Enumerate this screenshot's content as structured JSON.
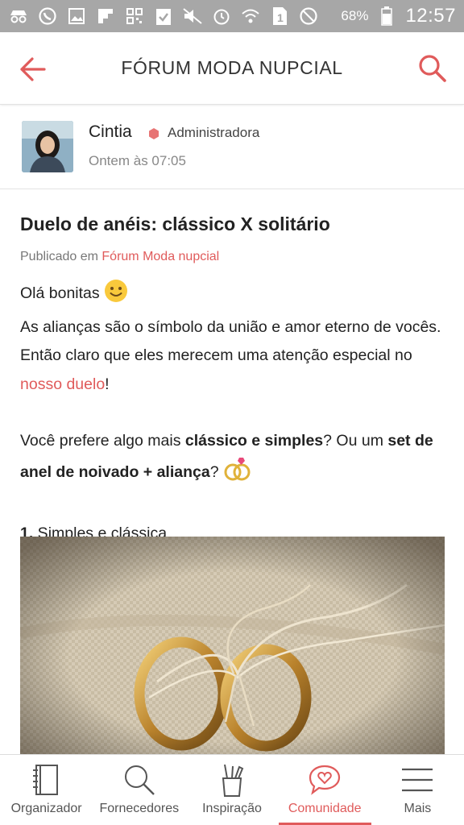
{
  "statusbar": {
    "left_icons": [
      "incognito-icon",
      "whatsapp-icon",
      "image-icon",
      "flipboard-icon",
      "qr-icon",
      "clipboard-icon",
      "mute-icon",
      "alarm-icon",
      "wifi-icon",
      "sim-icon",
      "block-icon"
    ],
    "battery": "68%",
    "time": "12:57"
  },
  "appbar": {
    "title": "FÓRUM MODA NUPCIAL",
    "back_icon": "arrow-left-icon",
    "search_icon": "search-icon"
  },
  "author": {
    "name": "Cintia",
    "role": "Administradora",
    "time": "Ontem às 07:05"
  },
  "post": {
    "title": "Duelo de anéis: clássico X solitário",
    "published_prefix": "Publicado em ",
    "published_forum": "Fórum Moda nupcial",
    "greeting": "Olá bonitas",
    "p1_text": "As alianças são o símbolo da união e amor eterno de vocês. Então claro que eles merecem uma atenção especial no ",
    "p1_link": "nosso duelo",
    "p1_end": "!",
    "p2_a": "Você prefere algo mais ",
    "p2_b": "clássico e simples",
    "p2_c": "? Ou um ",
    "p2_d": "set de anel de noivado + aliança",
    "p2_e": "?",
    "item1_num": "1.",
    "item1_text": " Simples e clássica"
  },
  "bottomnav": [
    {
      "label": "Organizador",
      "icon": "notebook-icon",
      "active": false
    },
    {
      "label": "Fornecedores",
      "icon": "search-icon",
      "active": false
    },
    {
      "label": "Inspiração",
      "icon": "pencil-cup-icon",
      "active": false
    },
    {
      "label": "Comunidade",
      "icon": "heart-chat-icon",
      "active": true
    },
    {
      "label": "Mais",
      "icon": "menu-icon",
      "active": false
    }
  ],
  "colors": {
    "accent": "#e05b5b",
    "statusbar": "#a7a7a7"
  }
}
